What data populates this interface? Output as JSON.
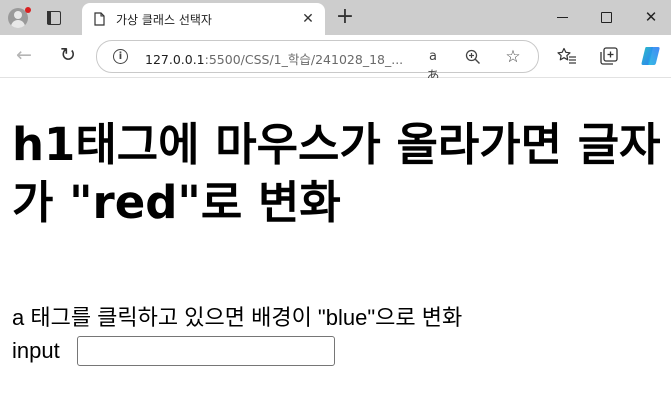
{
  "browser": {
    "tab": {
      "title": "가상 클래스 선택자",
      "close_glyph": "✕"
    },
    "new_tab_glyph": "+",
    "window_controls": {
      "minimize": "minimize-icon",
      "maximize": "maximize-icon",
      "close": "✕"
    },
    "toolbar": {
      "back_glyph": "←",
      "reload_glyph": "↻",
      "info_glyph": "i",
      "url_host": "127.0.0.1",
      "url_path": ":5500/CSS/1_학습/241028_18_...",
      "read_aloud_glyph": "aあ",
      "zoom_glyph": "⊕",
      "favorite_glyph": "☆",
      "favorites_glyph": "☆≡",
      "extensions_glyph": "⧉"
    },
    "accent_colors": {
      "copilot_blue": "#2f7bf5",
      "copilot_teal": "#2bc0c6",
      "notification": "#d92020"
    }
  },
  "page": {
    "heading": "h1태그에 마우스가 올라가면 글자가 \"red\"로 변화",
    "link_text": "a 태그를 클릭하고 있으면 배경이 \"blue\"으로 변화",
    "input_label": "input",
    "input_value": ""
  }
}
